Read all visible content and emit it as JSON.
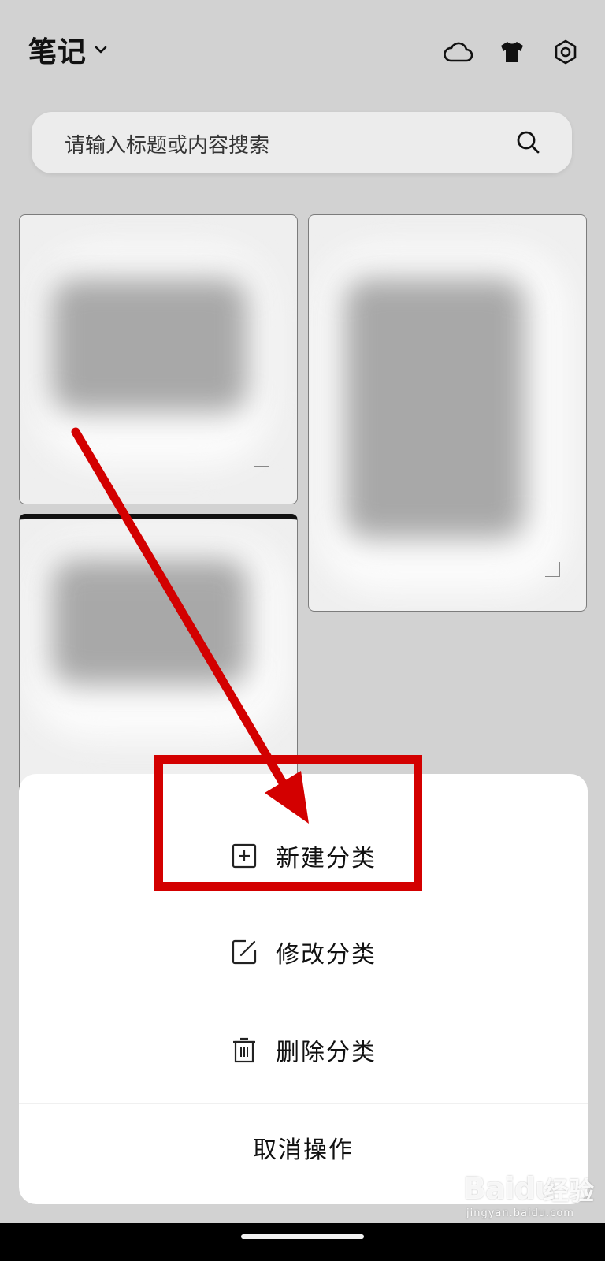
{
  "header": {
    "title": "笔记",
    "icons": [
      "chevron-down-icon",
      "cloud-icon",
      "tshirt-icon",
      "settings-icon"
    ]
  },
  "search": {
    "placeholder": "请输入标题或内容搜索"
  },
  "sheet": {
    "items": [
      {
        "label": "新建分类",
        "icon": "plus-square-icon"
      },
      {
        "label": "修改分类",
        "icon": "edit-icon"
      },
      {
        "label": "删除分类",
        "icon": "trash-icon"
      }
    ],
    "cancel_label": "取消操作"
  },
  "annotation": {
    "color": "#d30000"
  },
  "watermark": {
    "brand": "Baidu",
    "suffix": "经验",
    "url": "jingyan.baidu.com"
  }
}
